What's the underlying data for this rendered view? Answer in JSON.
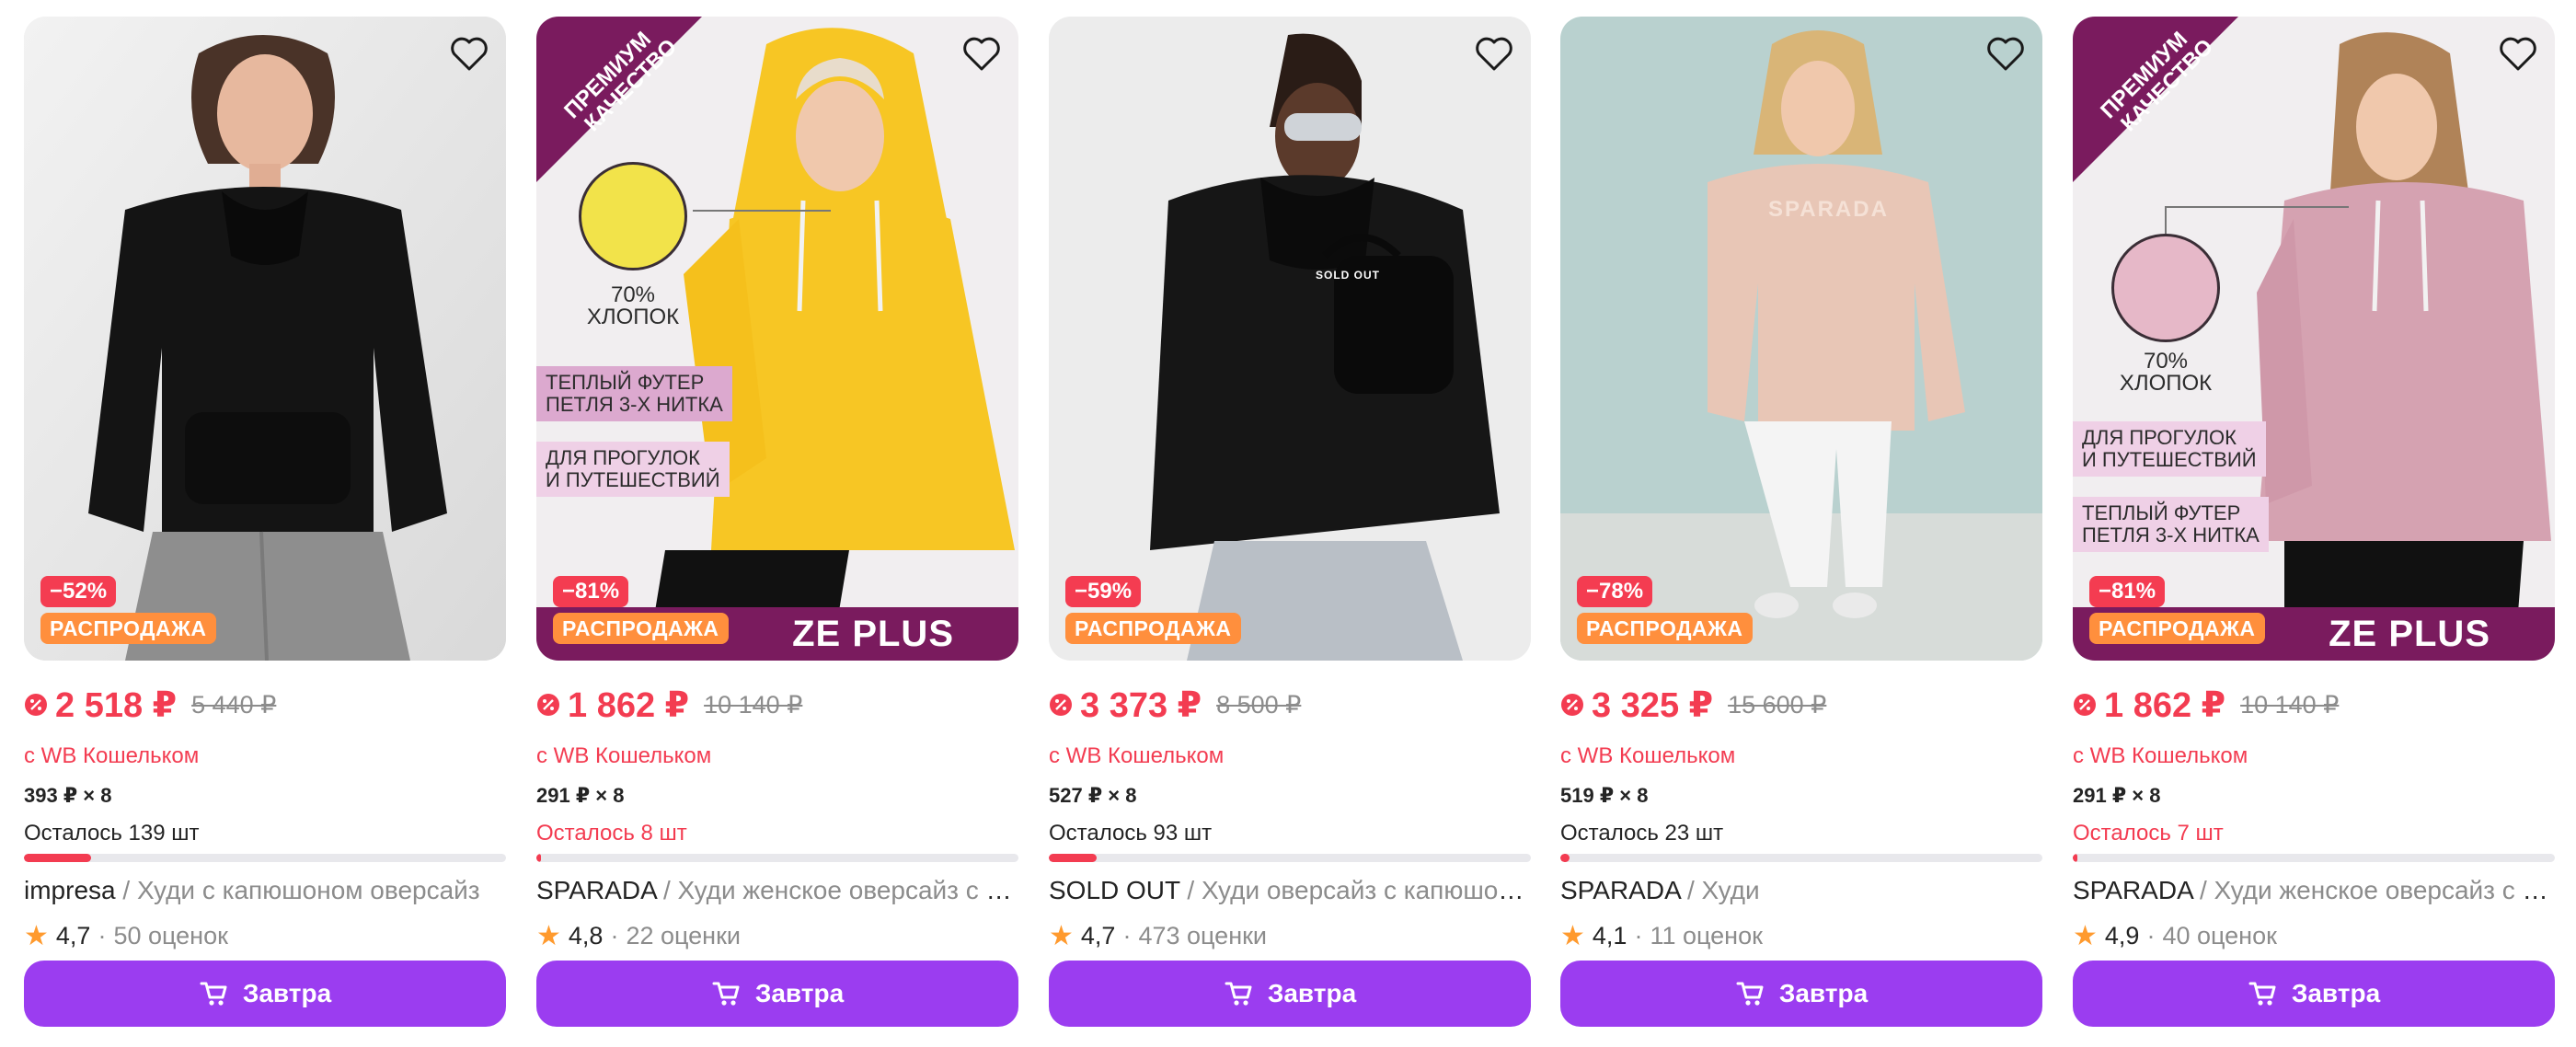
{
  "colors": {
    "price_red": "#f33c51",
    "discount_badge": "#f43c51",
    "sale_badge": "#ff8f3d",
    "button_purple": "#9b3df0",
    "promo_purple": "#7a1b5e",
    "rating_star": "#ff9a2e",
    "muted_text": "#8c8c8c"
  },
  "products": [
    {
      "discount": "−52%",
      "sale_label": "РАСПРОДАЖА",
      "price": "2 518 ₽",
      "old_price": "5 440 ₽",
      "wallet_note": "с WB Кошельком",
      "installment": "393 ₽ × 8",
      "stock": "Осталось 139 шт",
      "stock_level": 0.14,
      "brand": "impresa",
      "separator": " / ",
      "name": "Худи с капюшоном оверсайз",
      "rating": "4,7",
      "reviews": "50 оценок",
      "button_label": "Завтра",
      "image": {
        "kind": "plain",
        "bg": "#e8e8e8",
        "garment": "#141414",
        "pants": "#8e8e8e"
      }
    },
    {
      "discount": "−81%",
      "sale_label": "РАСПРОДАЖА",
      "price": "1 862 ₽",
      "old_price": "10 140 ₽",
      "wallet_note": "с WB Кошельком",
      "installment": "291 ₽ × 8",
      "stock": "Осталось 8 шт",
      "stock_level": 0.01,
      "brand": "SPARADA",
      "separator": " / ",
      "name": "Худи женское оверсайз с капюшоном",
      "rating": "4,8",
      "reviews": "22 оценки",
      "button_label": "Завтра",
      "image": {
        "kind": "promo",
        "bg": "#f1eef0",
        "garment": "#f7c624",
        "pants": "#111111",
        "corner_text_1": "ПРЕМИУМ",
        "corner_text_2": "КАЧЕСТВО",
        "fabric_color": "#f2e34a",
        "fabric_text_1": "70%",
        "fabric_text_2": "ХЛОПОК",
        "tag_1_line_1": "ТЕПЛЫЙ ФУТЕР",
        "tag_1_line_2": "ПЕТЛЯ 3-Х НИТКА",
        "tag_2_line_1": "ДЛЯ ПРОГУЛОК",
        "tag_2_line_2": "И ПУТЕШЕСТВИЙ",
        "band_text": "ZE PLUS"
      }
    },
    {
      "discount": "−59%",
      "sale_label": "РАСПРОДАЖА",
      "price": "3 373 ₽",
      "old_price": "8 500 ₽",
      "wallet_note": "с WB Кошельком",
      "installment": "527 ₽ × 8",
      "stock": "Осталось 93 шт",
      "stock_level": 0.1,
      "brand": "SOLD OUT",
      "separator": " / ",
      "name": "Худи оверсайз с капюшоном",
      "rating": "4,7",
      "reviews": "473 оценки",
      "button_label": "Завтра",
      "image": {
        "kind": "plain",
        "bg": "#ececec",
        "garment": "#161616",
        "pants": "#b9bfc6",
        "print": "SOLD OUT"
      }
    },
    {
      "discount": "−78%",
      "sale_label": "РАСПРОДАЖА",
      "price": "3 325 ₽",
      "old_price": "15 600 ₽",
      "wallet_note": "с WB Кошельком",
      "installment": "519 ₽ × 8",
      "stock": "Осталось 23 шт",
      "stock_level": 0.02,
      "brand": "SPARADA",
      "separator": " / ",
      "name": "Худи",
      "rating": "4,1",
      "reviews": "11 оценок",
      "button_label": "Завтра",
      "image": {
        "kind": "plain",
        "bg": "#b9d1cf",
        "garment": "#e8c6b6",
        "pants": "#f4f4f4",
        "print": "SPARADA"
      }
    },
    {
      "discount": "−81%",
      "sale_label": "РАСПРОДАЖА",
      "price": "1 862 ₽",
      "old_price": "10 140 ₽",
      "wallet_note": "с WB Кошельком",
      "installment": "291 ₽ × 8",
      "stock": "Осталось 7 шт",
      "stock_level": 0.01,
      "brand": "SPARADA",
      "separator": " / ",
      "name": "Худи женское оверсайз с капюшоном",
      "rating": "4,9",
      "reviews": "40 оценок",
      "button_label": "Завтра",
      "image": {
        "kind": "promo",
        "bg": "#f1eef0",
        "garment": "#d5a2b1",
        "pants": "#111111",
        "corner_text_1": "ПРЕМИУМ",
        "corner_text_2": "КАЧЕСТВО",
        "fabric_color": "#e6b8c8",
        "fabric_text_1": "70%",
        "fabric_text_2": "ХЛОПОК",
        "tag_1_line_1": "ДЛЯ ПРОГУЛОК",
        "tag_1_line_2": "И ПУТЕШЕСТВИЙ",
        "tag_2_line_1": "ТЕПЛЫЙ ФУТЕР",
        "tag_2_line_2": "ПЕТЛЯ 3-Х НИТКА",
        "band_text": "ZE PLUS"
      }
    }
  ]
}
